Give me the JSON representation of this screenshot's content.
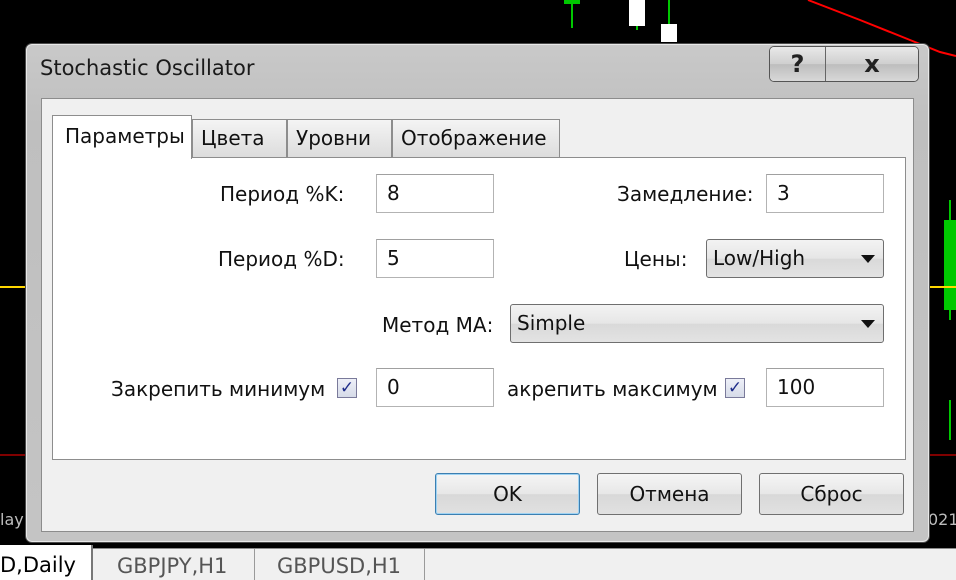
{
  "window": {
    "title": "Stochastic Oscillator",
    "help_label": "?",
    "close_label": "x"
  },
  "tabs": [
    {
      "label": "Параметры",
      "active": true
    },
    {
      "label": "Цвета",
      "active": false
    },
    {
      "label": "Уровни",
      "active": false
    },
    {
      "label": "Отображение",
      "active": false
    }
  ],
  "form": {
    "k_period": {
      "label": "Период %K:",
      "value": "8"
    },
    "d_period": {
      "label": "Период %D:",
      "value": "5"
    },
    "slowing": {
      "label": "Замедление:",
      "value": "3"
    },
    "price_field": {
      "label": "Цены:",
      "value": "Low/High"
    },
    "ma_method": {
      "label": "Метод МА:",
      "value": "Simple"
    },
    "fix_minimum": {
      "label": "Закрепить минимум",
      "checked": true,
      "value": "0"
    },
    "fix_maximum": {
      "label": "акрепить максимум",
      "checked": true,
      "value": "100"
    }
  },
  "buttons": {
    "ok": "OK",
    "cancel": "Отмена",
    "reset": "Сброс"
  },
  "chart_tabs": [
    {
      "label": "D,Daily",
      "active": true
    },
    {
      "label": "GBPJPY,H1",
      "active": false
    },
    {
      "label": "GBPUSD,H1",
      "active": false
    }
  ],
  "chart_edge": {
    "left_text": "lay",
    "right_text": "021"
  },
  "colors": {
    "chart_background": "#000000",
    "bull_candle": "#00c800",
    "bear_candle": "#ffffff",
    "ma_line": "#ff0000",
    "level_line": "#ffd700",
    "window_frame": "#c4c4c4",
    "default_button_border": "#3c7fb1"
  }
}
